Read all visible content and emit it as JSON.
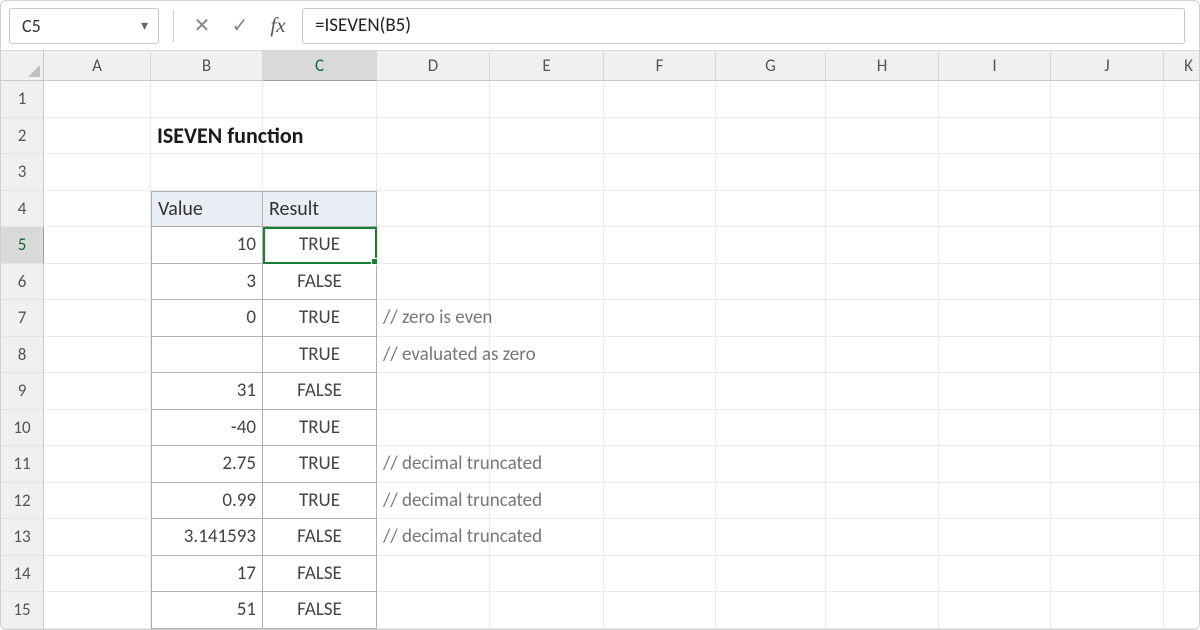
{
  "namebox": {
    "value": "C5"
  },
  "formula": {
    "value": "=ISEVEN(B5)"
  },
  "columns": [
    "A",
    "B",
    "C",
    "D",
    "E",
    "F",
    "G",
    "H",
    "I",
    "J",
    "K"
  ],
  "rowNumbers": [
    "1",
    "2",
    "3",
    "4",
    "5",
    "6",
    "7",
    "8",
    "9",
    "10",
    "11",
    "12",
    "13",
    "14",
    "15"
  ],
  "active": {
    "col": "C",
    "row": "5"
  },
  "title": "ISEVEN function",
  "headers": {
    "value": "Value",
    "result": "Result"
  },
  "rows": [
    {
      "value": "10",
      "result": "TRUE",
      "comment": ""
    },
    {
      "value": "3",
      "result": "FALSE",
      "comment": ""
    },
    {
      "value": "0",
      "result": "TRUE",
      "comment": "// zero is even"
    },
    {
      "value": "",
      "result": "TRUE",
      "comment": "// evaluated as zero"
    },
    {
      "value": "31",
      "result": "FALSE",
      "comment": ""
    },
    {
      "value": "-40",
      "result": "TRUE",
      "comment": ""
    },
    {
      "value": "2.75",
      "result": "TRUE",
      "comment": "// decimal truncated"
    },
    {
      "value": "0.99",
      "result": "TRUE",
      "comment": "// decimal truncated"
    },
    {
      "value": "3.141593",
      "result": "FALSE",
      "comment": "// decimal truncated"
    },
    {
      "value": "17",
      "result": "FALSE",
      "comment": ""
    },
    {
      "value": "51",
      "result": "FALSE",
      "comment": ""
    }
  ],
  "chart_data": {
    "type": "table",
    "title": "ISEVEN function",
    "columns": [
      "Value",
      "Result"
    ],
    "rows": [
      [
        "10",
        "TRUE"
      ],
      [
        "3",
        "FALSE"
      ],
      [
        "0",
        "TRUE"
      ],
      [
        "",
        "TRUE"
      ],
      [
        "31",
        "FALSE"
      ],
      [
        "-40",
        "TRUE"
      ],
      [
        "2.75",
        "TRUE"
      ],
      [
        "0.99",
        "TRUE"
      ],
      [
        "3.141593",
        "FALSE"
      ],
      [
        "17",
        "FALSE"
      ],
      [
        "51",
        "FALSE"
      ]
    ]
  }
}
